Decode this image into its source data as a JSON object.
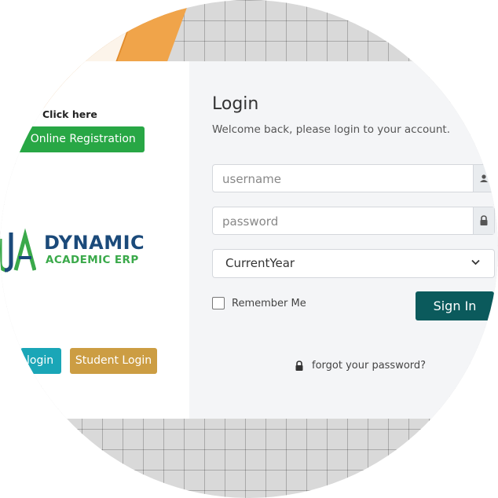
{
  "left_panel": {
    "click_here": "Click here",
    "registration_button": "y Online Registration",
    "brand": {
      "name": "DYNAMIC",
      "tagline": "ACADEMIC ERP"
    },
    "staff_login_button": "login",
    "student_login_button": "Student Login"
  },
  "login": {
    "title": "Login",
    "subtitle": "Welcome back, please login to your account.",
    "username_placeholder": "username",
    "password_placeholder": "password",
    "year_select_value": "CurrentYear",
    "remember_label": "Remember Me",
    "sign_in_button": "Sign In",
    "forgot_link": "forgot your password?"
  },
  "icons": {
    "user": "user-icon",
    "password": "lock-icon",
    "select": "chevron-down-icon",
    "forgot": "lock-icon"
  },
  "colors": {
    "registration": "#28a745",
    "staff_login": "#1aa6b7",
    "student_login": "#cc9d43",
    "sign_in": "#0b5a5c",
    "brand_blue": "#1b4a7a",
    "brand_green": "#3aa94a"
  }
}
